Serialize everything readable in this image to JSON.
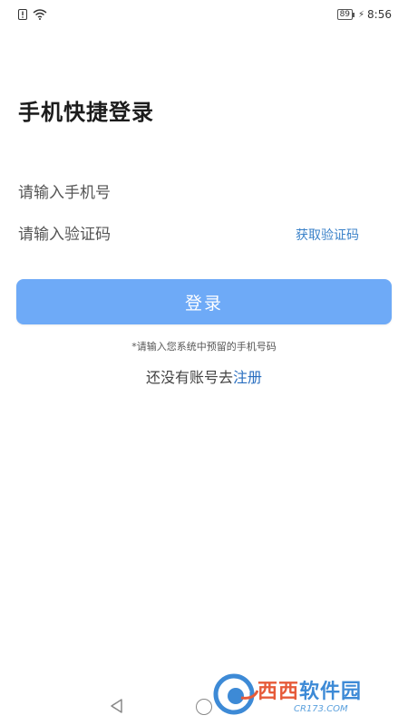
{
  "status_bar": {
    "battery": "89",
    "time": "8:56"
  },
  "title": "手机快捷登录",
  "phone_input": {
    "placeholder": "请输入手机号"
  },
  "code_input": {
    "placeholder": "请输入验证码",
    "get_code_label": "获取验证码"
  },
  "login_button": "登录",
  "hint": "*请输入您系统中预留的手机号码",
  "register": {
    "prefix": "还没有账号去",
    "link": "注册"
  },
  "watermark": {
    "main_red": "西西",
    "main_blue": "软件园",
    "sub": "CR173.COM"
  },
  "colors": {
    "accent": "#6eaaf7",
    "link": "#3b82c9"
  }
}
